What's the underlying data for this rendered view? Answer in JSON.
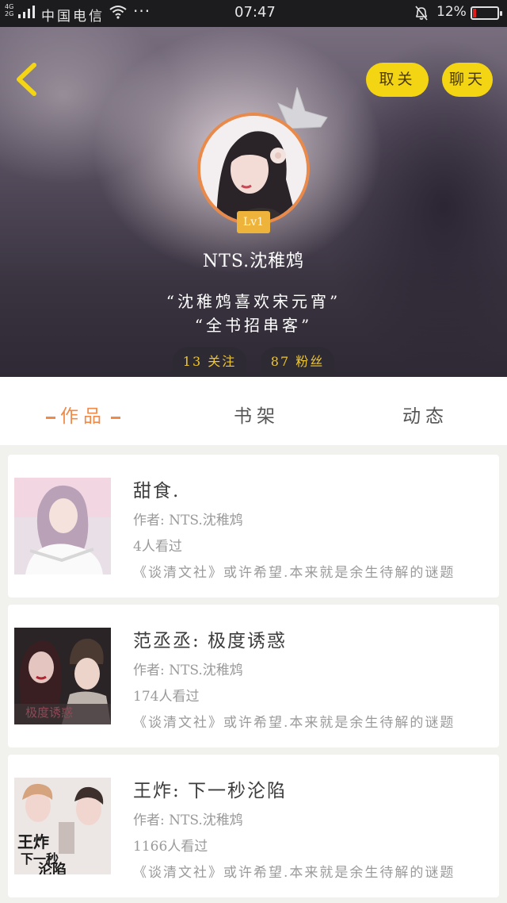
{
  "status_bar": {
    "network": "4G\n2G",
    "carrier": "中国电信",
    "more": "···",
    "time": "07:47",
    "battery_percent": "12%"
  },
  "header": {
    "unfollow_label": "取关",
    "chat_label": "聊天",
    "level": "Lv1",
    "username": "NTS.沈稚鸩",
    "motto_line1": "“沈稚鸩喜欢宋元宵”",
    "motto_line2": "“全书招串客”",
    "following": "13 关注",
    "fans": "87 粉丝"
  },
  "tabs": [
    {
      "label": "作品",
      "active": true
    },
    {
      "label": "书架",
      "active": false
    },
    {
      "label": "动态",
      "active": false
    }
  ],
  "works": [
    {
      "title": "甜食.",
      "author": "作者: NTS.沈稚鸩",
      "views": "4人看过",
      "desc": "《谈清文社》或许希望.本来就是余生待解的谜题"
    },
    {
      "title": "范丞丞: 极度诱惑",
      "author": "作者: NTS.沈稚鸩",
      "views": "174人看过",
      "desc": "《谈清文社》或许希望.本来就是余生待解的谜题"
    },
    {
      "title": "王炸: 下一秒沦陷",
      "author": "作者: NTS.沈稚鸩",
      "views": "1166人看过",
      "desc": "《谈清文社》或许希望.本来就是余生待解的谜题"
    }
  ],
  "colors": {
    "accent_yellow": "#f4d514",
    "accent_orange": "#ef8a48",
    "level_badge": "#eeb33a"
  },
  "icons": {
    "back": "chevron-left-icon",
    "crown": "crown-icon",
    "wifi": "wifi-icon",
    "mute": "bell-off-icon",
    "battery": "battery-icon"
  }
}
